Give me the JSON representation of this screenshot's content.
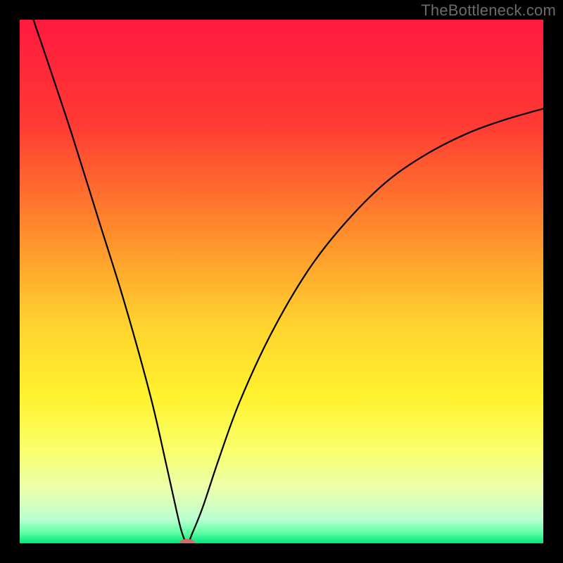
{
  "watermark": "TheBottleneck.com",
  "chart_data": {
    "type": "line",
    "title": "",
    "xlabel": "",
    "ylabel": "",
    "xlim": [
      0,
      100
    ],
    "ylim": [
      0,
      100
    ],
    "grid": false,
    "legend": false,
    "background_gradient_stops": [
      {
        "pos": 0.0,
        "color": "#ff1a3f"
      },
      {
        "pos": 0.2,
        "color": "#ff3a33"
      },
      {
        "pos": 0.4,
        "color": "#ff8a2c"
      },
      {
        "pos": 0.58,
        "color": "#ffd22e"
      },
      {
        "pos": 0.72,
        "color": "#fff22e"
      },
      {
        "pos": 0.82,
        "color": "#faff6a"
      },
      {
        "pos": 0.9,
        "color": "#e9ffb0"
      },
      {
        "pos": 0.955,
        "color": "#b8ffd0"
      },
      {
        "pos": 0.98,
        "color": "#5effa3"
      },
      {
        "pos": 1.0,
        "color": "#00e57a"
      }
    ],
    "series": [
      {
        "name": "bottleneck-curve",
        "x": [
          0,
          2,
          5,
          10,
          15,
          20,
          25,
          28,
          30,
          31,
          32,
          33,
          35,
          38,
          42,
          48,
          55,
          62,
          70,
          78,
          86,
          93,
          100
        ],
        "y": [
          110,
          102,
          93,
          78,
          62,
          46,
          28,
          15,
          6,
          2,
          0,
          2,
          7,
          16,
          27,
          40,
          52,
          61,
          69,
          74.5,
          78.5,
          81,
          83
        ]
      }
    ],
    "marker": {
      "x": 32,
      "y": 0,
      "color": "#d46a6a",
      "width_pct": 3.0,
      "height_pct": 1.6
    }
  }
}
